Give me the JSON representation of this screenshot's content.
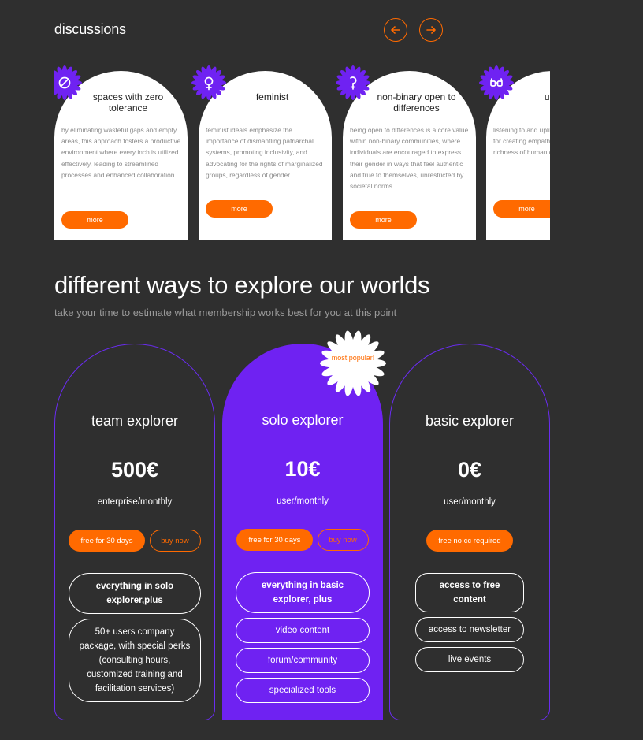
{
  "discussions": {
    "title": "discussions",
    "cards": [
      {
        "icon": "prohibited-icon",
        "title": "spaces with zero tolerance",
        "text": "by eliminating wasteful gaps and empty areas, this approach fosters a productive environment where every inch is utilized effectively, leading to streamlined processes and enhanced collaboration.",
        "button": "more"
      },
      {
        "icon": "female-symbol-icon",
        "title": "feminist",
        "text": "feminist ideals emphasize the importance of dismantling patriarchal systems, promoting inclusivity, and advocating for the rights of marginalized groups, regardless of gender.",
        "button": "more"
      },
      {
        "icon": "nonbinary-symbol-icon",
        "title": "non-binary open to differences",
        "text": "being open to differences is a core value within non-binary communities, where individuals are encouraged to express their gender in ways that feel authentic and true to themselves, unrestricted by societal norms.",
        "button": "more"
      },
      {
        "icon": "glasses-icon",
        "title": "unseen",
        "text": "listening to and uplifting voices is crucial for creating empathetic society that richness of human complexity of lived",
        "button": "more"
      }
    ]
  },
  "membership": {
    "heading": "different ways to explore our worlds",
    "subheading": "take your time to estimate what membership works best for you at this point",
    "badge": "most popular!",
    "plans": [
      {
        "name": "team explorer",
        "price": "500€",
        "period": "enterprise/monthly",
        "primary": "free for 30 days",
        "secondary": "buy now",
        "features": [
          "everything in solo explorer,plus",
          "50+ users company package, with special perks (consulting hours, customized training and facilitation services)"
        ]
      },
      {
        "name": "solo explorer",
        "price": "10€",
        "period": "user/monthly",
        "primary": "free for 30 days",
        "secondary": "buy now",
        "features": [
          "everything in basic explorer, plus",
          "video content",
          "forum/community",
          "specialized tools"
        ]
      },
      {
        "name": "basic explorer",
        "price": "0€",
        "period": "user/monthly",
        "primary": "free no cc required",
        "features": [
          "access to free content",
          "access to newsletter",
          "live events"
        ]
      }
    ]
  },
  "colors": {
    "accent": "#ff6a00",
    "brand": "#6f22f2",
    "background": "#2f2f2f"
  }
}
